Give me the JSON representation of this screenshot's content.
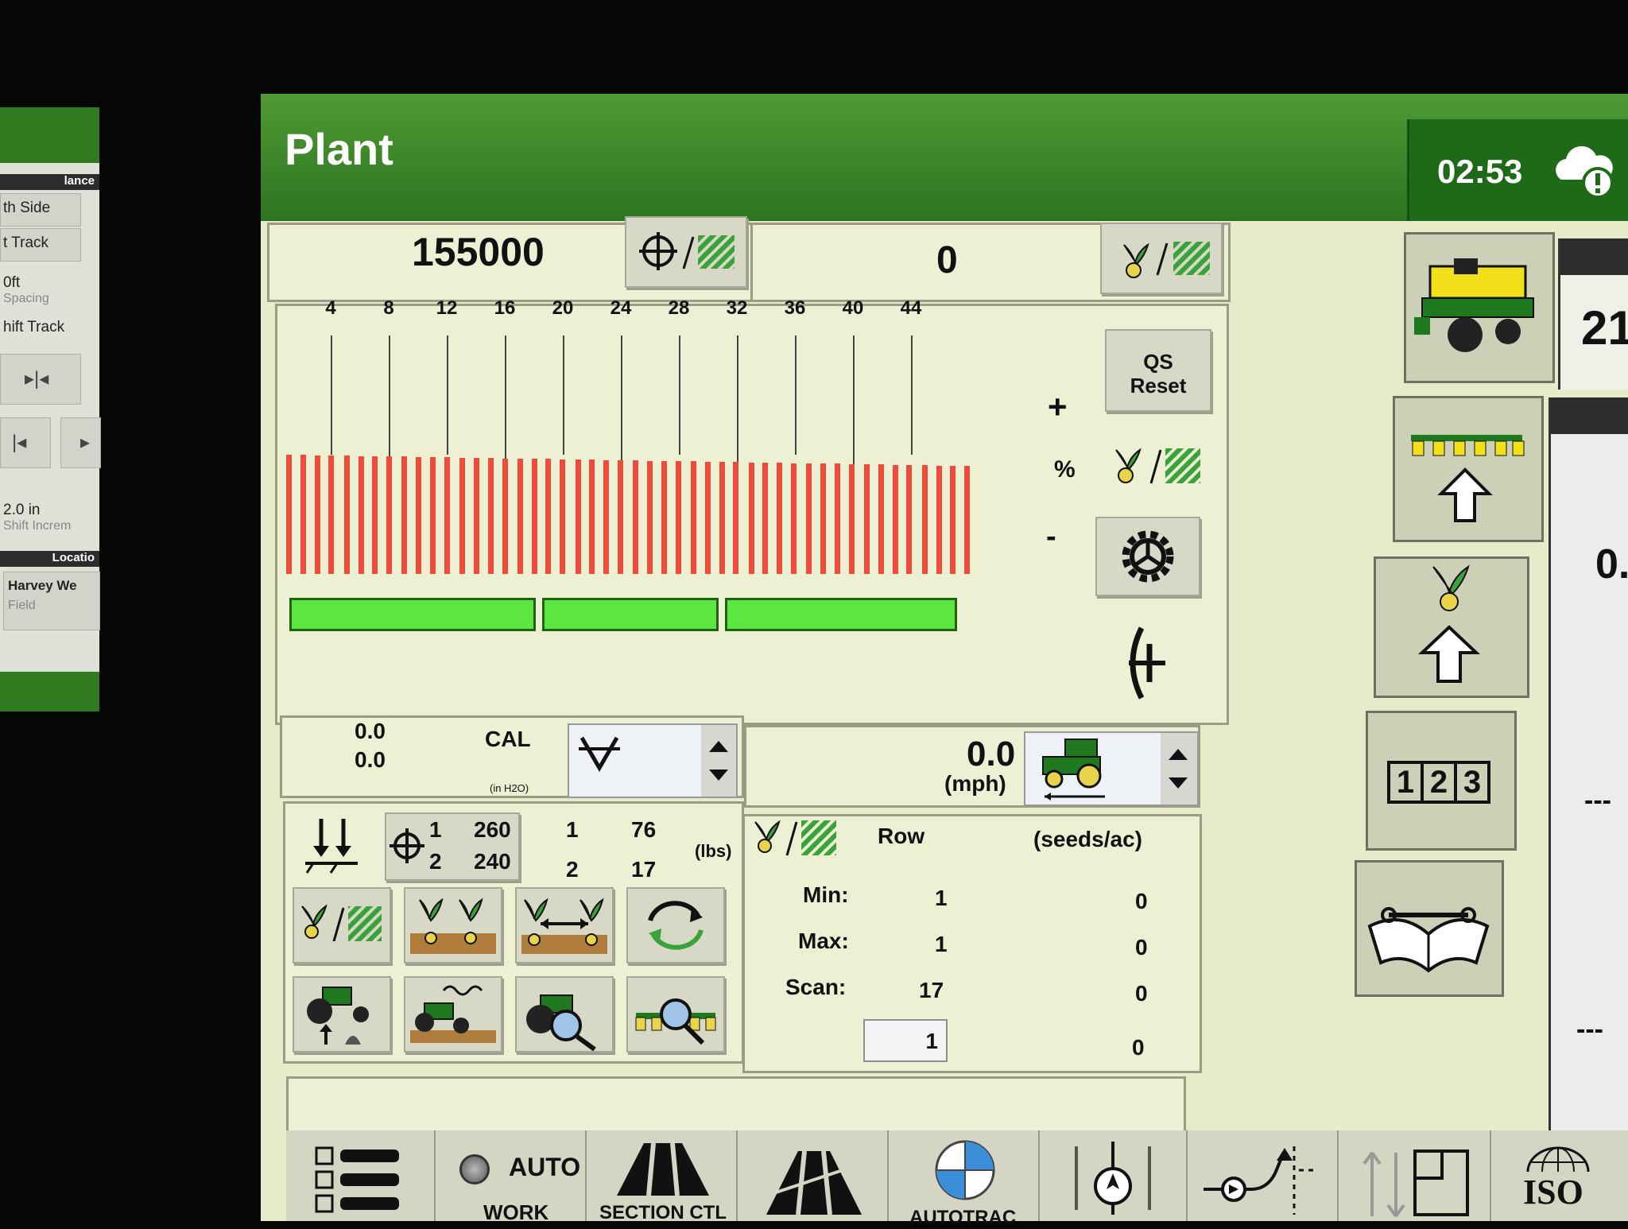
{
  "left_panel": {
    "header1": "lance",
    "items": [
      "th Side",
      "t Track",
      "0ft",
      "Spacing",
      "hift Track"
    ],
    "shift": "2.0 in",
    "shift_sub": "Shift Increm",
    "header2": "Locatio",
    "location": "Harvey We",
    "location_sub": "Field"
  },
  "header": {
    "title": "Plant",
    "clock": "02:53",
    "cloud_icon": "cloud-alert-icon"
  },
  "rate": {
    "target": "155000",
    "actual": "0"
  },
  "row_ticks": [
    "4",
    "8",
    "12",
    "16",
    "20",
    "24",
    "28",
    "32",
    "36",
    "40",
    "44"
  ],
  "row_bars": {
    "count": 48
  },
  "sections": {
    "count": 3
  },
  "controls": {
    "qs_reset_line1": "QS",
    "qs_reset_line2": "Reset",
    "plus": "+",
    "percent": "%",
    "minus": "-"
  },
  "vacuum": {
    "value1": "0.0",
    "value2": "0.0",
    "cal": "CAL",
    "unit": "(in H2O)"
  },
  "speed": {
    "value": "0.0",
    "unit": "(mph)"
  },
  "tank": {
    "rows": [
      {
        "num": "1",
        "val": "260",
        "col2": "1",
        "col3": "76"
      },
      {
        "num": "2",
        "val": "240",
        "col2": "2",
        "col3": "17"
      }
    ],
    "unit": "(lbs)"
  },
  "stats": {
    "row_label": "Row",
    "unit_label": "(seeds/ac)",
    "rows": [
      {
        "label": "Min:",
        "row": "1",
        "value": "0"
      },
      {
        "label": "Max:",
        "row": "1",
        "value": "0"
      },
      {
        "label": "Scan:",
        "row": "17",
        "value": "0"
      }
    ],
    "input_value": "1",
    "input_result": "0"
  },
  "side_buttons": {
    "counter_digits": [
      "1",
      "2",
      "3"
    ]
  },
  "right_cards": {
    "top": "21",
    "mid": "0.",
    "dash1": "---",
    "dash2": "---"
  },
  "tabs": [
    {
      "line1": "AUTO",
      "line2": "WORK"
    },
    {
      "line1": "SECTION CTL"
    },
    {
      "line1": ""
    },
    {
      "line1": "AUTOTRAC"
    },
    {
      "line1": ""
    },
    {
      "line1": ""
    },
    {
      "line1": ""
    },
    {
      "line1": "ISO"
    }
  ],
  "colors": {
    "header_green": "#2c7420",
    "row_bar": "#f04a3a",
    "section_green": "#5ee640",
    "screen_bg": "#e7ebca"
  }
}
